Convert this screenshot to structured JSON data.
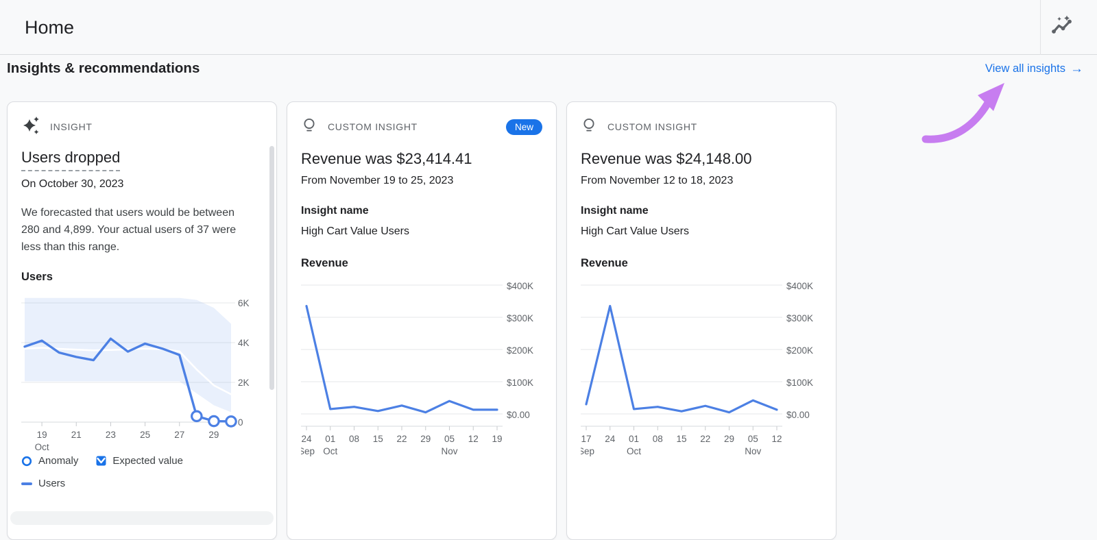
{
  "header": {
    "title": "Home"
  },
  "section": {
    "heading": "Insights & recommendations",
    "view_all_label": "View all insights",
    "view_all_arrow": "→"
  },
  "colors": {
    "link_blue": "#1a73e8",
    "new_badge_bg": "#1a73e8",
    "chart_line_blue": "#4c80e4",
    "forecast_band": "rgba(76,128,228,0.12)",
    "annotation_arrow_purple": "#c77df0",
    "icon_gray": "#5f6368"
  },
  "cards": [
    {
      "tag": "INSIGHT",
      "title": "Users dropped",
      "subtitle": "On October 30, 2023",
      "body": "We forecasted that users would be between 280 and 4,899. Your actual users of 37 were less than this range.",
      "chart_title": "Users",
      "legend": {
        "anomaly": "Anomaly",
        "expected": "Expected value",
        "users": "Users"
      }
    },
    {
      "tag": "CUSTOM INSIGHT",
      "new_badge": "New",
      "title": "Revenue was $23,414.41",
      "subtitle": "From November 19 to 25, 2023",
      "insight_name_label": "Insight name",
      "insight_name": "High Cart Value Users",
      "chart_title": "Revenue"
    },
    {
      "tag": "CUSTOM INSIGHT",
      "title": "Revenue was $24,148.00",
      "subtitle": "From November 12 to 18, 2023",
      "insight_name_label": "Insight name",
      "insight_name": "High Cart Value Users",
      "chart_title": "Revenue"
    }
  ],
  "chart_data": [
    {
      "type": "line",
      "title": "Users",
      "x": [
        "Oct 18",
        "Oct 19",
        "Oct 20",
        "Oct 21",
        "Oct 22",
        "Oct 23",
        "Oct 24",
        "Oct 25",
        "Oct 26",
        "Oct 27",
        "Oct 28",
        "Oct 29",
        "Oct 30"
      ],
      "series": [
        {
          "name": "Users",
          "values": [
            3800,
            4100,
            3500,
            3280,
            3120,
            4200,
            3550,
            3950,
            3700,
            3380,
            300,
            50,
            37
          ]
        },
        {
          "name": "Expected value",
          "values": [
            3700,
            3740,
            3690,
            3650,
            3610,
            3630,
            3660,
            3700,
            3670,
            3560,
            2650,
            1850,
            1400
          ]
        }
      ],
      "band": {
        "name": "Expected range",
        "upper": [
          6250,
          6250,
          6250,
          6250,
          6250,
          6250,
          6250,
          6250,
          6250,
          6250,
          6150,
          5750,
          4950
        ],
        "lower": [
          2050,
          2050,
          2050,
          2050,
          2050,
          2050,
          2050,
          2050,
          2050,
          2050,
          1450,
          850,
          500
        ]
      },
      "anomaly_indexes": [
        10,
        11,
        12
      ],
      "x_tick_labels": [
        "19",
        "21",
        "23",
        "25",
        "27",
        "29"
      ],
      "x_tick_indexes": [
        1,
        3,
        5,
        7,
        9,
        11
      ],
      "x_tick_months": {
        "0": "Oct"
      },
      "y_tick_values": [
        6000,
        4000,
        2000,
        0
      ],
      "y_tick_labels": [
        "6K",
        "4K",
        "2K",
        "0"
      ],
      "ylim": [
        0,
        6500
      ],
      "legend_position": "bottom",
      "grid": true
    },
    {
      "type": "line",
      "title": "Revenue",
      "x": [
        "Sep 24",
        "Oct 01",
        "Oct 08",
        "Oct 15",
        "Oct 22",
        "Oct 29",
        "Nov 05",
        "Nov 12",
        "Nov 19"
      ],
      "values": [
        335000,
        15000,
        22000,
        9000,
        26000,
        5000,
        40000,
        13000,
        13000
      ],
      "x_tick_labels": [
        "24",
        "01",
        "08",
        "15",
        "22",
        "29",
        "05",
        "12",
        "19"
      ],
      "x_tick_months": {
        "0": "Sep",
        "1": "Oct",
        "6": "Nov"
      },
      "y_tick_values": [
        400000,
        300000,
        200000,
        100000,
        0
      ],
      "y_tick_labels": [
        "$400K",
        "$300K",
        "$200K",
        "$100K",
        "$0.00"
      ],
      "ylim": [
        0,
        400000
      ],
      "grid": true
    },
    {
      "type": "line",
      "title": "Revenue",
      "x": [
        "Sep 17",
        "Sep 24",
        "Oct 01",
        "Oct 08",
        "Oct 15",
        "Oct 22",
        "Oct 29",
        "Nov 05",
        "Nov 12"
      ],
      "values": [
        30000,
        335000,
        15000,
        22000,
        8000,
        25000,
        5000,
        42000,
        13000
      ],
      "x_tick_labels": [
        "17",
        "24",
        "01",
        "08",
        "15",
        "22",
        "29",
        "05",
        "12"
      ],
      "x_tick_months": {
        "0": "Sep",
        "2": "Oct",
        "7": "Nov"
      },
      "y_tick_values": [
        400000,
        300000,
        200000,
        100000,
        0
      ],
      "y_tick_labels": [
        "$400K",
        "$300K",
        "$200K",
        "$100K",
        "$0.00"
      ],
      "ylim": [
        0,
        400000
      ],
      "grid": true
    }
  ]
}
